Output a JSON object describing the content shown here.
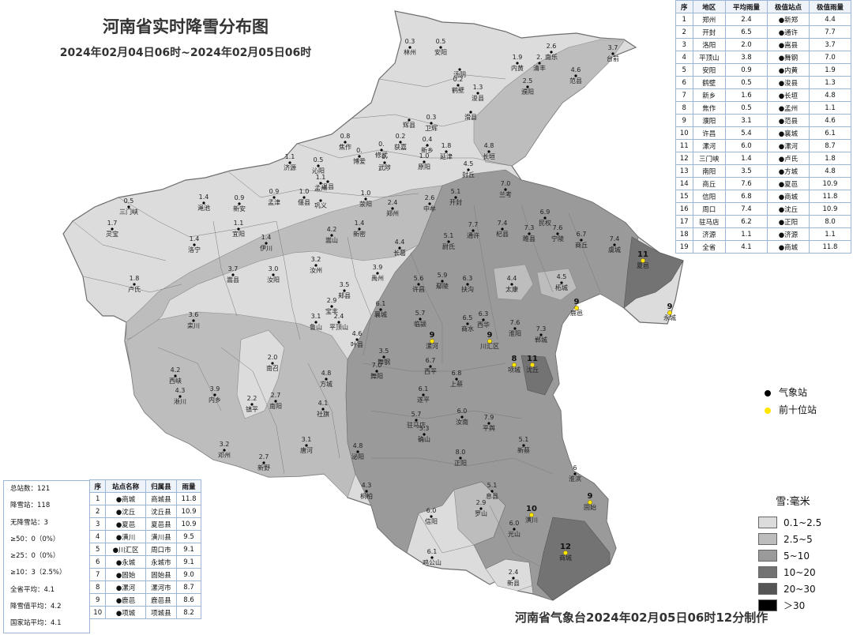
{
  "title": "河南省实时降雪分布图",
  "subtitle": "2024年02月04日06时~2024年02月05日06时",
  "footer": "河南省气象台2024年02月05日06时12分制作",
  "right_table": {
    "headers": [
      "序",
      "地区",
      "平均雨量",
      "极值站点",
      "极值雨量"
    ],
    "rows": [
      [
        "1",
        "郑州",
        "2.4",
        "●新郑",
        "4.4"
      ],
      [
        "2",
        "开封",
        "6.5",
        "●通许",
        "7.7"
      ],
      [
        "3",
        "洛阳",
        "2.0",
        "●嵩县",
        "3.7"
      ],
      [
        "4",
        "平顶山",
        "3.8",
        "●舞钢",
        "7.0"
      ],
      [
        "5",
        "安阳",
        "0.9",
        "●内黄",
        "1.9"
      ],
      [
        "6",
        "鹤壁",
        "0.5",
        "●浚县",
        "1.3"
      ],
      [
        "7",
        "新乡",
        "1.6",
        "●长垣",
        "4.8"
      ],
      [
        "8",
        "焦作",
        "0.5",
        "●孟州",
        "1.1"
      ],
      [
        "9",
        "濮阳",
        "3.1",
        "●范县",
        "4.6"
      ],
      [
        "10",
        "许昌",
        "5.4",
        "●襄城",
        "6.1"
      ],
      [
        "11",
        "漯河",
        "6.0",
        "●漯河",
        "8.7"
      ],
      [
        "12",
        "三门峡",
        "1.4",
        "●卢氏",
        "1.8"
      ],
      [
        "13",
        "南阳",
        "3.5",
        "●方城",
        "4.8"
      ],
      [
        "14",
        "商丘",
        "7.6",
        "●夏邑",
        "10.9"
      ],
      [
        "15",
        "信阳",
        "6.8",
        "●商城",
        "11.8"
      ],
      [
        "16",
        "周口",
        "7.4",
        "●沈丘",
        "10.9"
      ],
      [
        "17",
        "驻马店",
        "6.2",
        "●正阳",
        "8.0"
      ],
      [
        "18",
        "济源",
        "1.1",
        "●济源",
        "1.1"
      ],
      [
        "19",
        "全省",
        "4.1",
        "●商城",
        "11.8"
      ]
    ]
  },
  "bottom_table": {
    "headers": [
      "序",
      "站点名称",
      "归属县",
      "雨量"
    ],
    "rows": [
      [
        "1",
        "●商城",
        "商城县",
        "11.8"
      ],
      [
        "2",
        "●沈丘",
        "沈丘县",
        "10.9"
      ],
      [
        "3",
        "●夏邑",
        "夏邑县",
        "10.9"
      ],
      [
        "4",
        "●潢川",
        "潢川县",
        "9.5"
      ],
      [
        "5",
        "●川汇区",
        "周口市",
        "9.1"
      ],
      [
        "6",
        "●永城",
        "永城市",
        "9.1"
      ],
      [
        "7",
        "●固始",
        "固始县",
        "9.0"
      ],
      [
        "8",
        "●漯河",
        "漯河市",
        "8.7"
      ],
      [
        "9",
        "●鹿邑",
        "鹿邑县",
        "8.6"
      ],
      [
        "10",
        "●项城",
        "项城县",
        "8.2"
      ]
    ]
  },
  "stats": [
    "总站数：121",
    "降雪站：118",
    "无降雪站：3",
    "≥50：0（0%）",
    "≥25：0（0%）",
    "≥10：3（2.5%）",
    "全省平均：4.1",
    "降雪值平均：4.2",
    "国家站平均：4.1"
  ],
  "point_legend": {
    "weather_station": "气象站",
    "top_ten": "前十位站"
  },
  "snow_legend": {
    "title": "雪:毫米",
    "classes": [
      {
        "label": "0.1~2.5",
        "color": "#dcdcdc"
      },
      {
        "label": "2.5~5",
        "color": "#bdbdbd"
      },
      {
        "label": "5~10",
        "color": "#9a9a9a"
      },
      {
        "label": "10~20",
        "color": "#737373"
      },
      {
        "label": "20~30",
        "color": "#555555"
      },
      {
        "label": "＞30",
        "color": "#000000"
      }
    ]
  },
  "stations": [
    {
      "name": "林州",
      "v": "0.3"
    },
    {
      "name": "安阳",
      "v": "0.5"
    },
    {
      "name": "内黄",
      "v": "1.9"
    },
    {
      "name": "南乐",
      "v": "2.6"
    },
    {
      "name": "清丰",
      "v": "2."
    },
    {
      "name": "台前",
      "v": "3.7"
    },
    {
      "name": "范县",
      "v": "4.6"
    },
    {
      "name": "汤阴",
      "v": ""
    },
    {
      "name": "鹤壁",
      "v": "0.2"
    },
    {
      "name": "浚县",
      "v": "1.3"
    },
    {
      "name": "滑县",
      "v": ""
    },
    {
      "name": "濮阳",
      "v": "2.5"
    },
    {
      "name": "辉县",
      "v": ""
    },
    {
      "name": "卫辉",
      "v": "0.3"
    },
    {
      "name": "获嘉",
      "v": "0.2"
    },
    {
      "name": "新乡",
      "v": "0.4"
    },
    {
      "name": "延津",
      "v": "1.8"
    },
    {
      "name": "长垣",
      "v": "4.8"
    },
    {
      "name": "封丘",
      "v": "4.5"
    },
    {
      "name": "原阳",
      "v": "1.0"
    },
    {
      "name": "修武",
      "v": "0."
    },
    {
      "name": "博爱",
      "v": "0."
    },
    {
      "name": "武陟",
      "v": "0."
    },
    {
      "name": "焦作",
      "v": "0.8"
    },
    {
      "name": "沁阳",
      "v": "0.5"
    },
    {
      "name": "济源",
      "v": "1.1"
    },
    {
      "name": "孟州",
      "v": "1.1"
    },
    {
      "name": "温县",
      "v": ""
    },
    {
      "name": "偃县",
      "v": "1.0"
    },
    {
      "name": "巩义",
      "v": ""
    },
    {
      "name": "荥阳",
      "v": "1.0"
    },
    {
      "name": "郑州",
      "v": "2.4"
    },
    {
      "name": "中牟",
      "v": "2.6"
    },
    {
      "name": "开封",
      "v": "5.1"
    },
    {
      "name": "兰考",
      "v": "7.0"
    },
    {
      "name": "三门峡",
      "v": "0.5"
    },
    {
      "name": "渑池",
      "v": "1.4"
    },
    {
      "name": "新安",
      "v": "0.9"
    },
    {
      "name": "孟津",
      "v": "0.9"
    },
    {
      "name": "灵宝",
      "v": "1.7"
    },
    {
      "name": "宜阳",
      "v": "1.1"
    },
    {
      "name": "伊川",
      "v": "1.4"
    },
    {
      "name": "嵩山",
      "v": "4.2"
    },
    {
      "name": "新密",
      "v": "1.4"
    },
    {
      "name": "长葛",
      "v": "4.4"
    },
    {
      "name": "尉氏",
      "v": "5.1"
    },
    {
      "name": "通许",
      "v": "7.7"
    },
    {
      "name": "杞县",
      "v": "7.4"
    },
    {
      "name": "睢县",
      "v": "7.3"
    },
    {
      "name": "民权",
      "v": "6.9"
    },
    {
      "name": "宁陵",
      "v": "7.6"
    },
    {
      "name": "商丘",
      "v": "6.7"
    },
    {
      "name": "虞城",
      "v": "7.4"
    },
    {
      "name": "夏邑",
      "v": "11"
    },
    {
      "name": "永城",
      "v": "9"
    },
    {
      "name": "洛宁",
      "v": "1.4"
    },
    {
      "name": "卢氏",
      "v": "1.8"
    },
    {
      "name": "嵩县",
      "v": "3.7"
    },
    {
      "name": "汝阳",
      "v": "3.0"
    },
    {
      "name": "汝州",
      "v": "3.2"
    },
    {
      "name": "禹州",
      "v": "3.9"
    },
    {
      "name": "许昌",
      "v": "5.6"
    },
    {
      "name": "鄢陵",
      "v": "5.9"
    },
    {
      "name": "扶沟",
      "v": "6.3"
    },
    {
      "name": "太康",
      "v": "4.4"
    },
    {
      "name": "柘城",
      "v": "4.5"
    },
    {
      "name": "鹿邑",
      "v": "9"
    },
    {
      "name": "郏县",
      "v": "3.5"
    },
    {
      "name": "宝丰",
      "v": "2.9"
    },
    {
      "name": "鲁山",
      "v": "3.1"
    },
    {
      "name": "平顶山",
      "v": "2.4"
    },
    {
      "name": "叶县",
      "v": "4.6"
    },
    {
      "name": "襄城",
      "v": "6.1"
    },
    {
      "name": "临颍",
      "v": "5.7"
    },
    {
      "name": "漯河",
      "v": "9"
    },
    {
      "name": "川汇区",
      "v": "9"
    },
    {
      "name": "西华",
      "v": "6.3"
    },
    {
      "name": "淮阳",
      "v": "7.6"
    },
    {
      "name": "郸城",
      "v": "7.3"
    },
    {
      "name": "商水",
      "v": "6.5"
    },
    {
      "name": "项城",
      "v": "8"
    },
    {
      "name": "沈丘",
      "v": "11"
    },
    {
      "name": "栾川",
      "v": "3.6"
    },
    {
      "name": "南召",
      "v": "2.0"
    },
    {
      "name": "方城",
      "v": "4.8"
    },
    {
      "name": "舞阳",
      "v": "7.0"
    },
    {
      "name": "舞钢",
      "v": "3.5"
    },
    {
      "name": "西平",
      "v": "6.7"
    },
    {
      "name": "上蔡",
      "v": "6.8"
    },
    {
      "name": "西峡",
      "v": "4.2"
    },
    {
      "name": "淅川",
      "v": "4.3"
    },
    {
      "name": "内乡",
      "v": "3.9"
    },
    {
      "name": "镇平",
      "v": "2.2"
    },
    {
      "name": "南阳",
      "v": "2.7"
    },
    {
      "name": "社旗",
      "v": "4.1"
    },
    {
      "name": "遂平",
      "v": "6.1"
    },
    {
      "name": "汝南",
      "v": "6.0"
    },
    {
      "name": "平舆",
      "v": "7.9"
    },
    {
      "name": "驻马店",
      "v": "5.7"
    },
    {
      "name": "确山",
      "v": "5.3"
    },
    {
      "name": "邓州",
      "v": "3.2"
    },
    {
      "name": "唐河",
      "v": "3.1"
    },
    {
      "name": "泌阳",
      "v": "4.8"
    },
    {
      "name": "新野",
      "v": "2.7"
    },
    {
      "name": "新蔡",
      "v": "5.1"
    },
    {
      "name": "正阳",
      "v": "8.0"
    },
    {
      "name": "桐柏",
      "v": "4.3"
    },
    {
      "name": "淮滨",
      "v": "6"
    },
    {
      "name": "息县",
      "v": "5.1"
    },
    {
      "name": "罗山",
      "v": "2.9"
    },
    {
      "name": "潢川",
      "v": "10"
    },
    {
      "name": "固始",
      "v": "9"
    },
    {
      "name": "信阳",
      "v": "6.0"
    },
    {
      "name": "光山",
      "v": "6.0"
    },
    {
      "name": "商城",
      "v": "12"
    },
    {
      "name": "鸡公山",
      "v": "6.1"
    },
    {
      "name": "新县",
      "v": "2.4"
    }
  ]
}
